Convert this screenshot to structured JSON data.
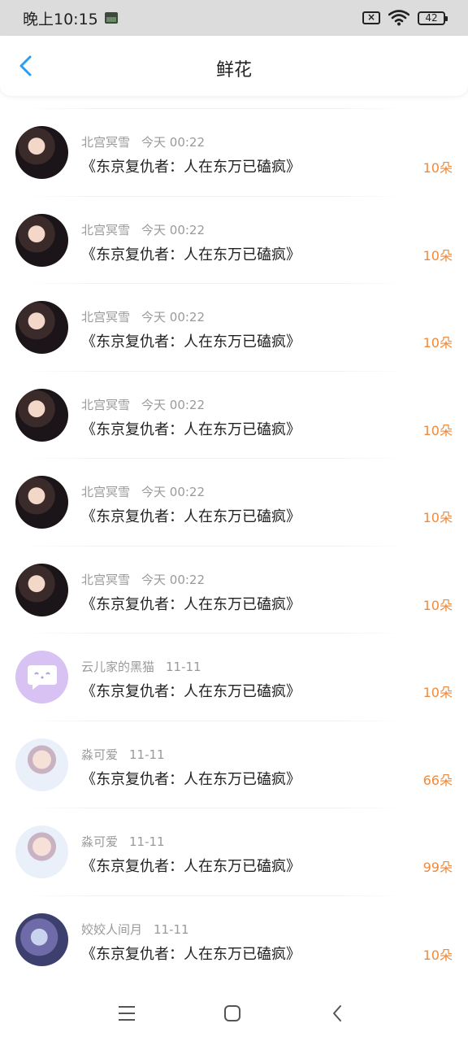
{
  "status_bar": {
    "time": "晚上10:15",
    "battery": "42"
  },
  "header": {
    "title": "鲜花",
    "back_icon": "chevron-left-icon"
  },
  "colors": {
    "accent_blue": "#2a9df4",
    "amount_orange": "#ef8a3b",
    "muted_text": "#9a9a9a"
  },
  "rows": [
    {
      "name": "北宫冥雪",
      "time": "今天 00:22",
      "book": "《东京复仇者：人在东万已磕疯》",
      "amount": "10朵",
      "avatar": "dark"
    },
    {
      "name": "北宫冥雪",
      "time": "今天 00:22",
      "book": "《东京复仇者：人在东万已磕疯》",
      "amount": "10朵",
      "avatar": "dark"
    },
    {
      "name": "北宫冥雪",
      "time": "今天 00:22",
      "book": "《东京复仇者：人在东万已磕疯》",
      "amount": "10朵",
      "avatar": "dark"
    },
    {
      "name": "北宫冥雪",
      "time": "今天 00:22",
      "book": "《东京复仇者：人在东万已磕疯》",
      "amount": "10朵",
      "avatar": "dark"
    },
    {
      "name": "北宫冥雪",
      "time": "今天 00:22",
      "book": "《东京复仇者：人在东万已磕疯》",
      "amount": "10朵",
      "avatar": "dark"
    },
    {
      "name": "北宫冥雪",
      "time": "今天 00:22",
      "book": "《东京复仇者：人在东万已磕疯》",
      "amount": "10朵",
      "avatar": "dark"
    },
    {
      "name": "云儿家的黑猫",
      "time": "11-11",
      "book": "《东京复仇者：人在东万已磕疯》",
      "amount": "10朵",
      "avatar": "purple"
    },
    {
      "name": "淼可爱",
      "time": "11-11",
      "book": "《东京复仇者：人在东万已磕疯》",
      "amount": "66朵",
      "avatar": "boy"
    },
    {
      "name": "淼可爱",
      "time": "11-11",
      "book": "《东京复仇者：人在东万已磕疯》",
      "amount": "99朵",
      "avatar": "boy"
    },
    {
      "name": "姣姣人间月",
      "time": "11-11",
      "book": "《东京复仇者：人在东万已磕疯》",
      "amount": "10朵",
      "avatar": "anime"
    }
  ],
  "navbar": {
    "menu_icon": "menu-icon",
    "home_icon": "home-square-icon",
    "back_icon": "back-triangle-icon"
  }
}
